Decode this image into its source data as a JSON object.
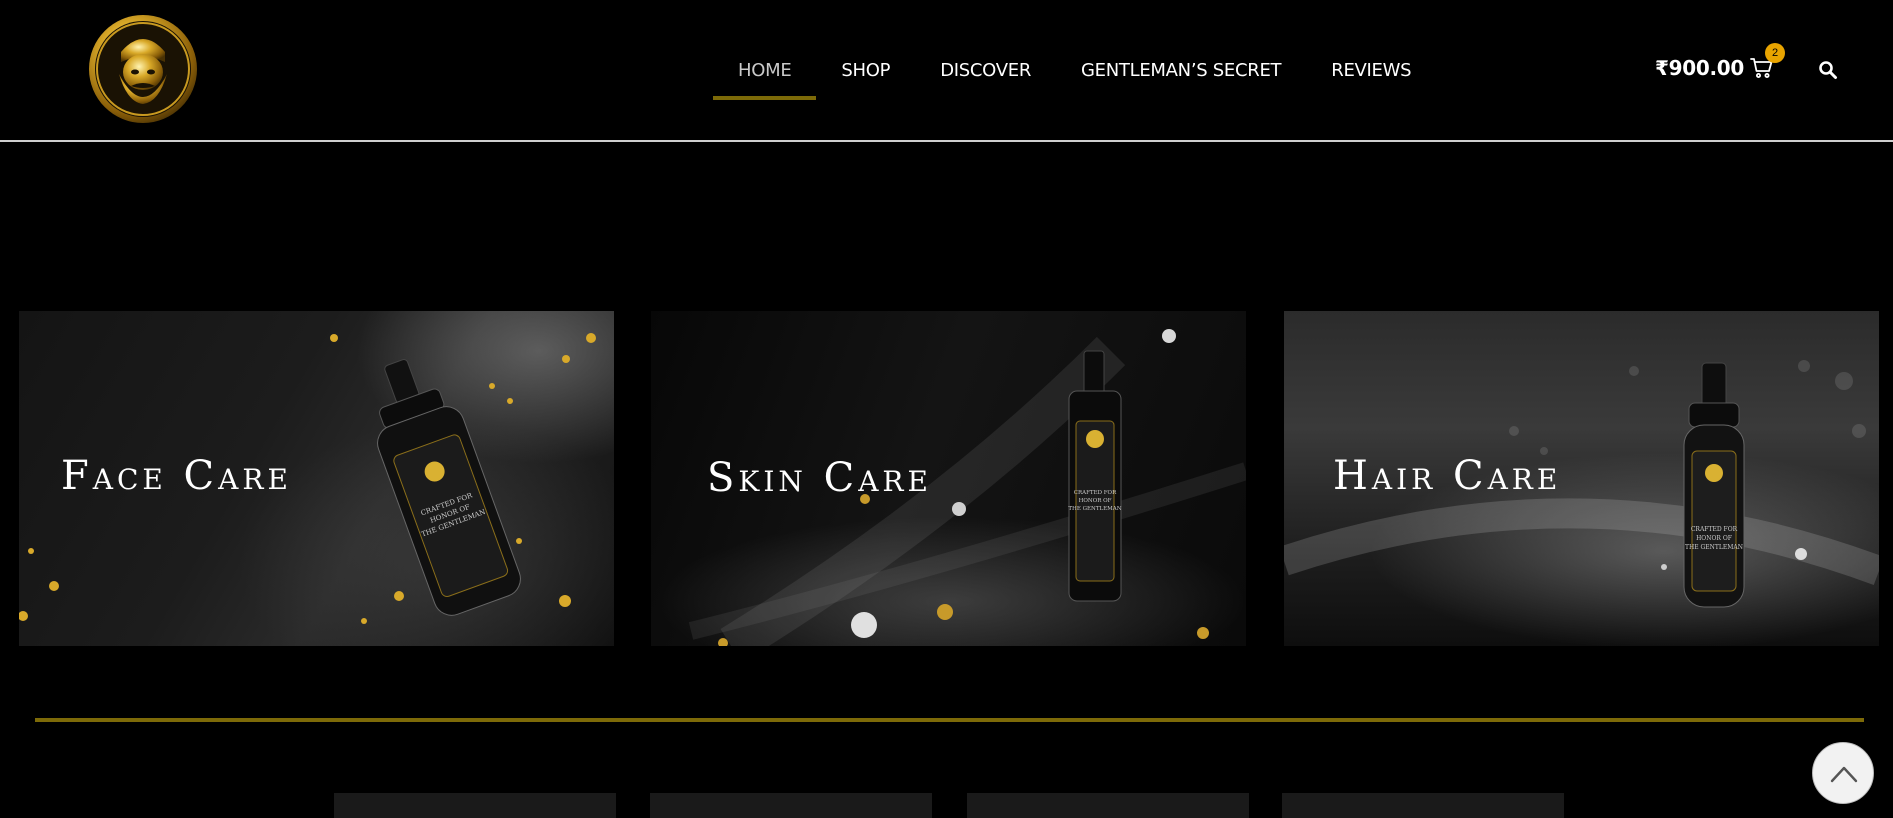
{
  "header": {
    "nav": [
      {
        "label": "HOME",
        "active": true
      },
      {
        "label": "SHOP",
        "active": false
      },
      {
        "label": "DISCOVER",
        "active": false
      },
      {
        "label": "GENTLEMAN’S SECRET",
        "active": false
      },
      {
        "label": "REVIEWS",
        "active": false
      }
    ],
    "cart": {
      "total": "₹900.00",
      "count": "2"
    },
    "search_icon": "search-icon",
    "cart_icon": "shopping-cart-icon"
  },
  "categories": [
    {
      "title": "Face Care"
    },
    {
      "title": "Skin Care"
    },
    {
      "title": "Hair Care"
    }
  ],
  "colors": {
    "accent_gold": "#7d6a08",
    "badge": "#e8a400",
    "background": "#000000"
  },
  "scroll_top_icon": "chevron-up-icon"
}
